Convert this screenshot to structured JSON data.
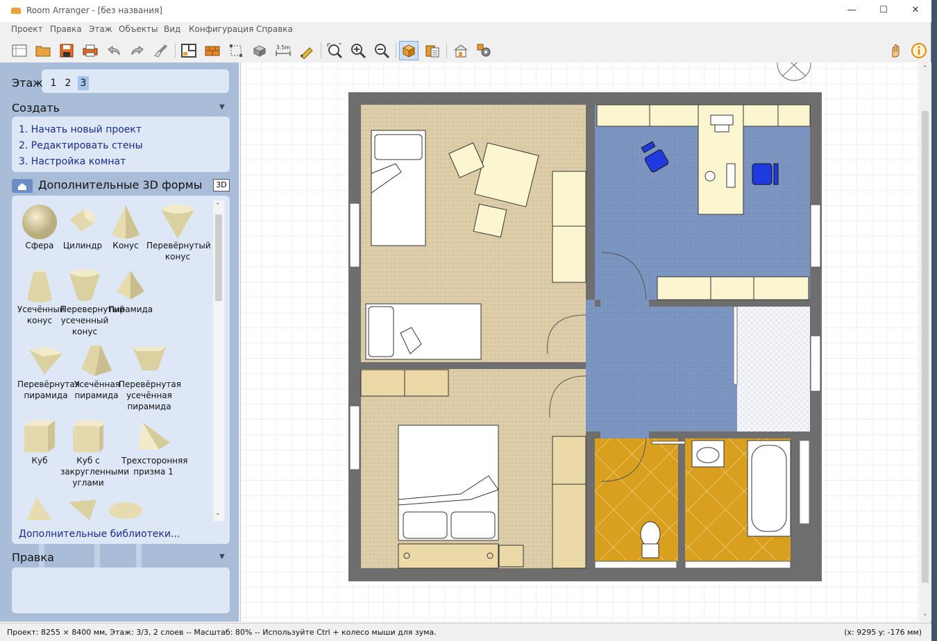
{
  "window": {
    "title": "Room Arranger - [без названия]",
    "min": "—",
    "max": "☐",
    "close": "✕"
  },
  "menu": [
    "Проект",
    "Правка",
    "Этаж",
    "Объекты",
    "Вид",
    "Конфигурация",
    "Справка"
  ],
  "toolbar": {
    "icons": [
      "new-document-icon",
      "open-folder-icon",
      "save-icon",
      "print-icon",
      "undo-icon",
      "redo-icon",
      "brush-icon",
      "floor-plan-icon",
      "wall-brick-icon",
      "room-corners-icon",
      "object-3d-icon",
      "dimension-3.5m-icon",
      "measure-pencil-icon",
      "zoom-fit-icon",
      "zoom-in-icon",
      "zoom-out-icon",
      "box-3d-icon",
      "library-icon",
      "house-3d-icon",
      "settings-gear-icon",
      "hand-tool-icon",
      "info-icon"
    ],
    "dimension_label": "3.5m"
  },
  "floor": {
    "label": "Этаж",
    "tabs": [
      "1",
      "2",
      "3"
    ],
    "selected": "3"
  },
  "create": {
    "title": "Создать",
    "steps": [
      "1. Начать новый проект",
      "2. Редактировать стены",
      "3. Настройка комнат"
    ]
  },
  "shapes": {
    "title": "Дополнительные 3D формы",
    "badge": "3D",
    "items": [
      {
        "label": "Сфера",
        "icon": "sphere-shape-icon"
      },
      {
        "label": "Цилиндр",
        "icon": "cylinder-shape-icon"
      },
      {
        "label": "Конус",
        "icon": "cone-shape-icon"
      },
      {
        "label": "Перевёрнутый конус",
        "icon": "inverted-cone-shape-icon"
      },
      {
        "label": "Усечённый конус",
        "icon": "truncated-cone-shape-icon"
      },
      {
        "label": "Перевернутый усеченный конус",
        "icon": "inverted-truncated-cone-shape-icon"
      },
      {
        "label": "Пирамида",
        "icon": "pyramid-shape-icon"
      },
      {
        "label": "Перевёрнутая пирамида",
        "icon": "inverted-pyramid-shape-icon"
      },
      {
        "label": "Усечённая пирамида",
        "icon": "truncated-pyramid-shape-icon"
      },
      {
        "label": "Перевёрнутая усечённая пирамида",
        "icon": "inverted-truncated-pyramid-shape-icon"
      },
      {
        "label": "Куб",
        "icon": "cube-shape-icon"
      },
      {
        "label": "Куб с закругленными углами",
        "icon": "rounded-cube-shape-icon"
      },
      {
        "label": "Трехсторонняя призма 1",
        "icon": "triangular-prism-shape-icon"
      }
    ],
    "more": "Дополнительные библиотеки..."
  },
  "edit": {
    "title": "Правка"
  },
  "colors": {
    "carpet": "#dccda8",
    "blue_floor": "#7b95c0",
    "tile": "#d9a020",
    "wall": "#6e6e6e",
    "furniture": "#fbf6d0",
    "accent": "#1a2b8c"
  },
  "status": {
    "left": "Проект: 8255 × 8400 мм, Этаж: 3/3, 2 слоев -- Масштаб: 80% -- Используйте Ctrl + колесо мыши для зума.",
    "coords": "(x: 9295 y: -176 мм)"
  }
}
